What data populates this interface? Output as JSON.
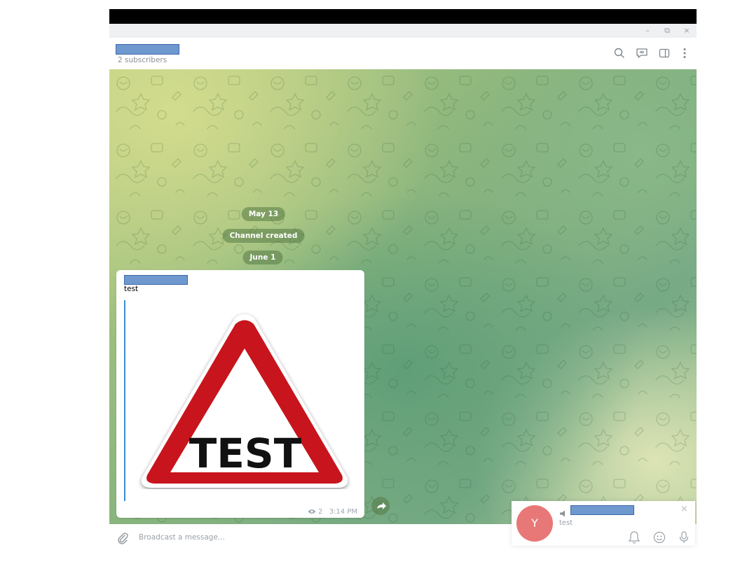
{
  "window": {
    "controls": {
      "minimize": "–",
      "restore": "⧉",
      "close": "×"
    }
  },
  "header": {
    "subtitle": "2 subscribers",
    "icons": [
      "search-icon",
      "discussion-icon",
      "sidebar-toggle-icon",
      "more-menu-icon"
    ]
  },
  "chat": {
    "service_messages": [
      "May 13",
      "Channel created",
      "June 1"
    ],
    "message": {
      "text": "test",
      "image_text": "TEST",
      "views": "2",
      "time": "3:14 PM"
    }
  },
  "composer": {
    "placeholder": "Broadcast a message..."
  },
  "notification": {
    "avatar_letter": "Y",
    "text": "test",
    "close": "×"
  },
  "colors": {
    "accent": "#3a8fd0",
    "avatar": "#e87878",
    "sign_red": "#c8141c"
  }
}
